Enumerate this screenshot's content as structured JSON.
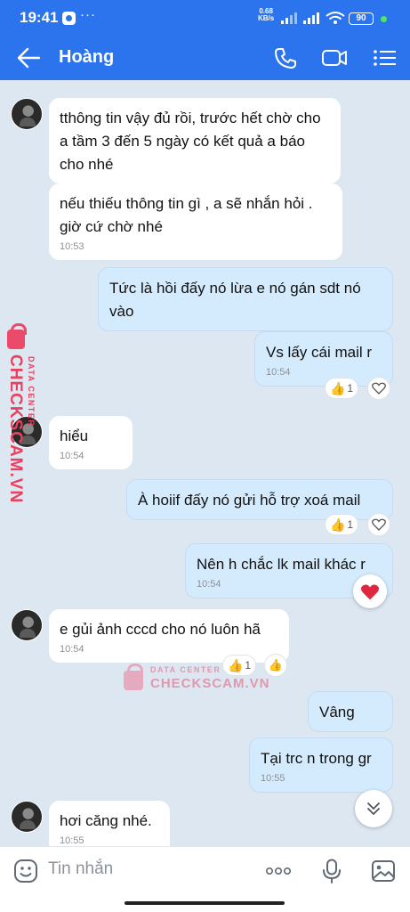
{
  "status_bar": {
    "time": "19:41",
    "dots": "···",
    "net_speed": "0.68",
    "net_unit": "KB/s",
    "battery": "90"
  },
  "header": {
    "contact_name": "Hoàng"
  },
  "messages": [
    {
      "side": "in",
      "text": "tthông tin vậy đủ rồi, trước hết chờ cho a tầm 3 đến 5 ngày có kết quả a báo cho nhé",
      "time": ""
    },
    {
      "side": "in",
      "text": "nếu thiếu thông tin gì , a sẽ nhắn hỏi . giờ cứ chờ nhé",
      "time": "10:53"
    },
    {
      "side": "out",
      "text": "Tức là hồi đấy nó lừa e nó gán sdt nó vào",
      "time": ""
    },
    {
      "side": "out",
      "text": "Vs lấy cái mail r",
      "time": "10:54",
      "reaction_count": "1"
    },
    {
      "side": "in",
      "text": "hiểu",
      "time": "10:54"
    },
    {
      "side": "out",
      "text": "À hoiif đấy nó gửi hỗ trợ xoá mail",
      "time": "",
      "reaction_count": "1"
    },
    {
      "side": "out",
      "text": "Nên h chắc lk mail khác r",
      "time": "10:54"
    },
    {
      "side": "in",
      "text": "e gủi ảnh cccd cho nó luôn hã",
      "time": "10:54",
      "reaction_count": "1"
    },
    {
      "side": "out",
      "text": "Vâng",
      "time": ""
    },
    {
      "side": "out",
      "text": "Tại trc n trong gr",
      "time": "10:55"
    },
    {
      "side": "in",
      "text": "hơi căng nhé.",
      "time": "10:55"
    }
  ],
  "watermark": {
    "brand": "CHECKSCAM.VN",
    "sub": "DATA CENTER"
  },
  "composer": {
    "placeholder": "Tin nhắn"
  },
  "colors": {
    "header_bg": "#2b74ee",
    "chat_bg": "#dde7f2",
    "outgoing_bubble": "#d4ebfd",
    "incoming_bubble": "#ffffff"
  }
}
